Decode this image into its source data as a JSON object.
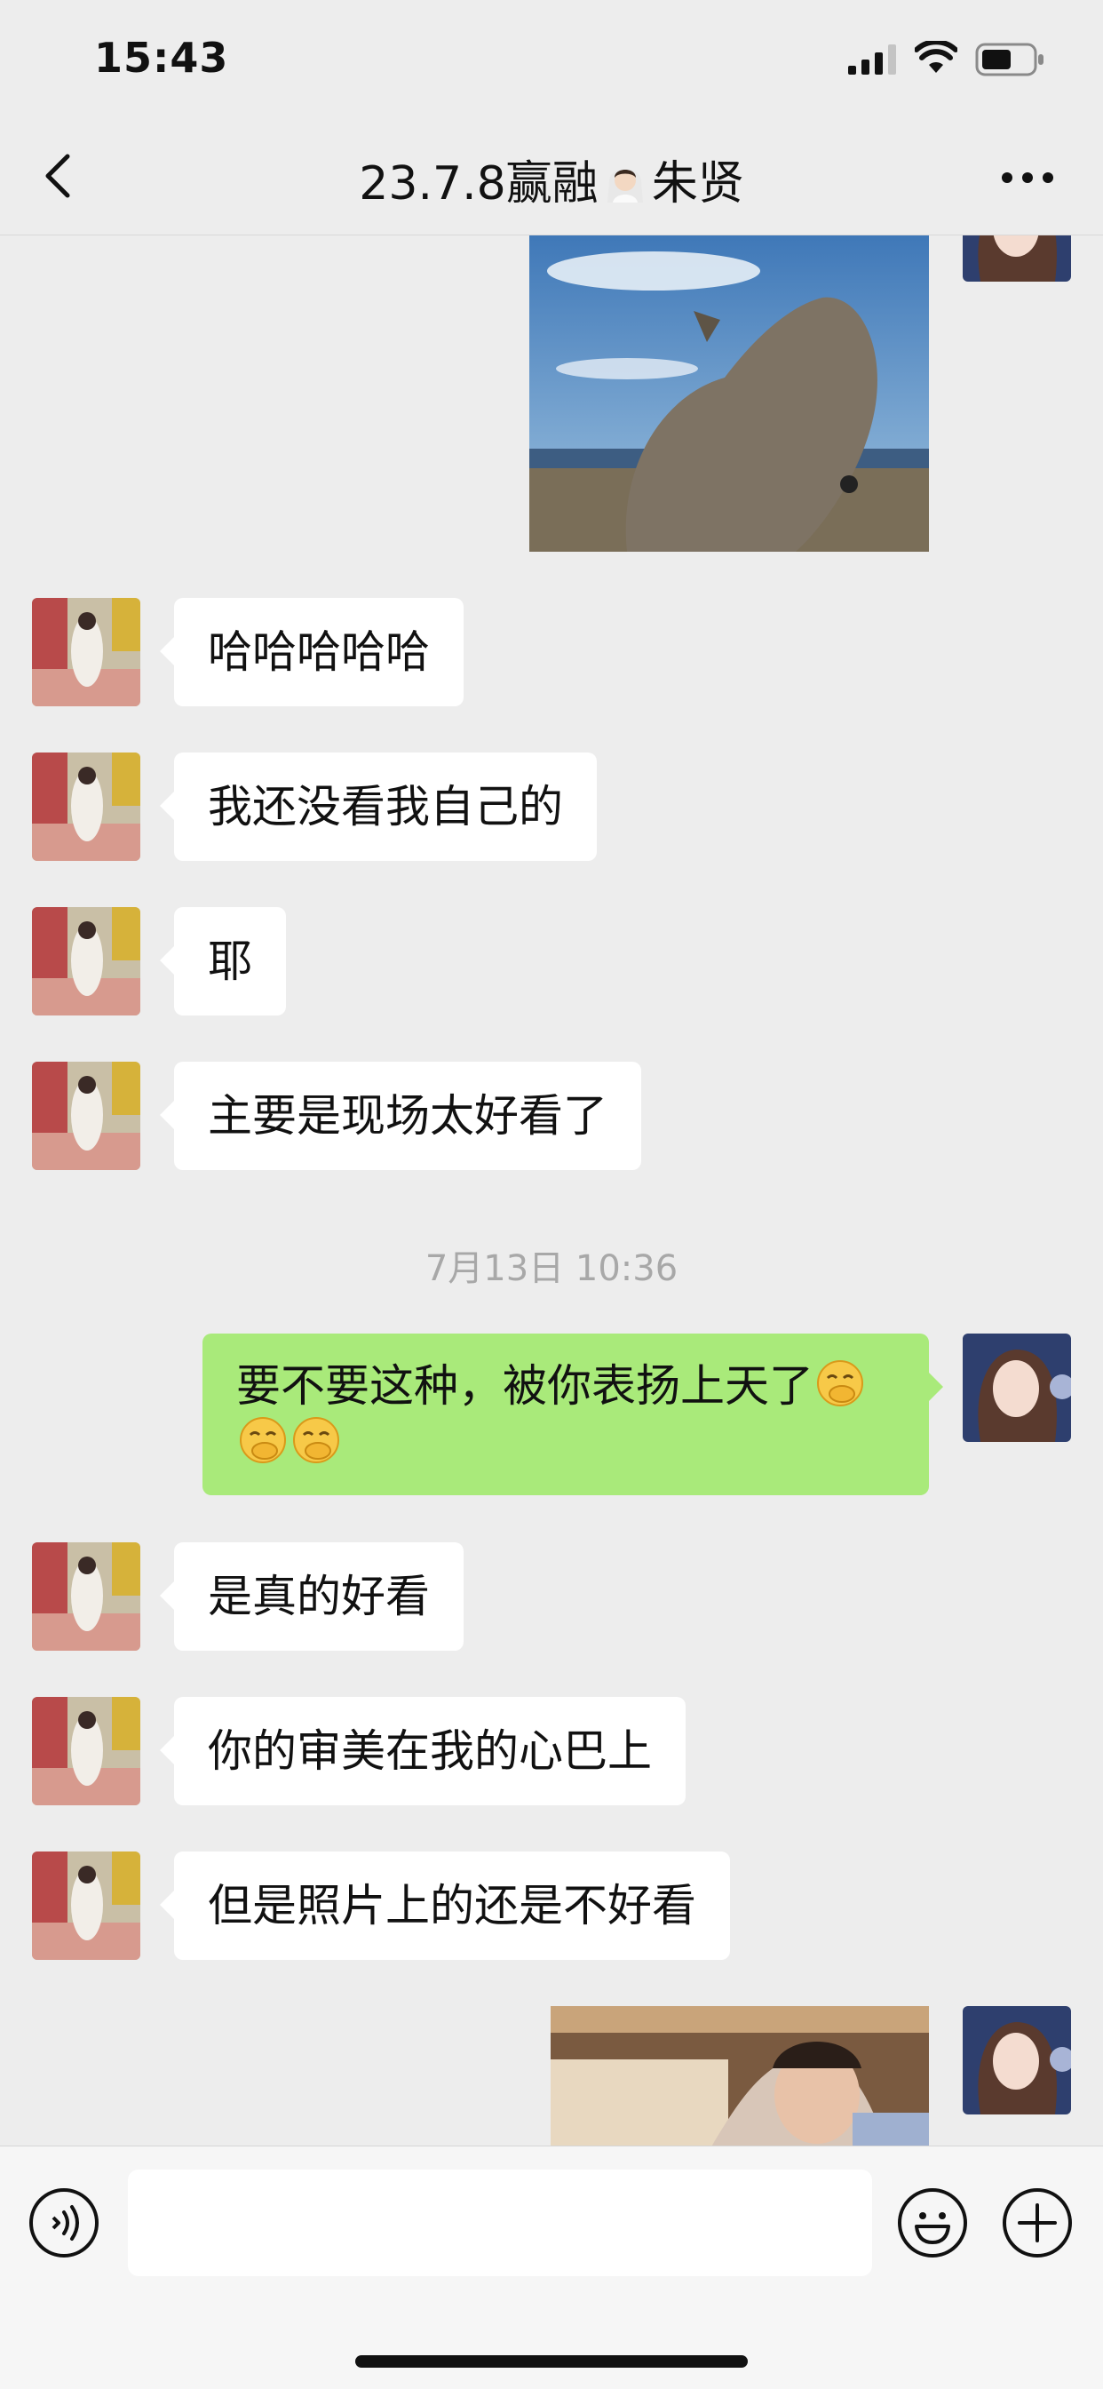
{
  "status_bar": {
    "time": "15:43"
  },
  "header": {
    "title_part1": "23.7.8赢融",
    "title_part2": "朱贤"
  },
  "messages": {
    "m1": "哈哈哈哈哈",
    "m2": "我还没看我自己的",
    "m3": "耶",
    "m4": "主要是现场太好看了",
    "timestamp": "7月13日 10:36",
    "m5": "要不要这种，被你表扬上天了",
    "m6": "是真的好看",
    "m7": "你的审美在我的心巴上",
    "m8": "但是照片上的还是不好看"
  },
  "icons": {
    "back": "chevron-left-icon",
    "more": "ellipsis-icon",
    "voice": "voice-icon",
    "emoji": "smiley-icon",
    "plus": "plus-icon",
    "title_emoji": "bride-emoji",
    "msg_emoji": "hand-over-mouth-emoji"
  },
  "colors": {
    "background": "#ededed",
    "sent_bubble": "#a9ea7a",
    "received_bubble": "#ffffff",
    "timestamp": "#a8a8a8"
  }
}
